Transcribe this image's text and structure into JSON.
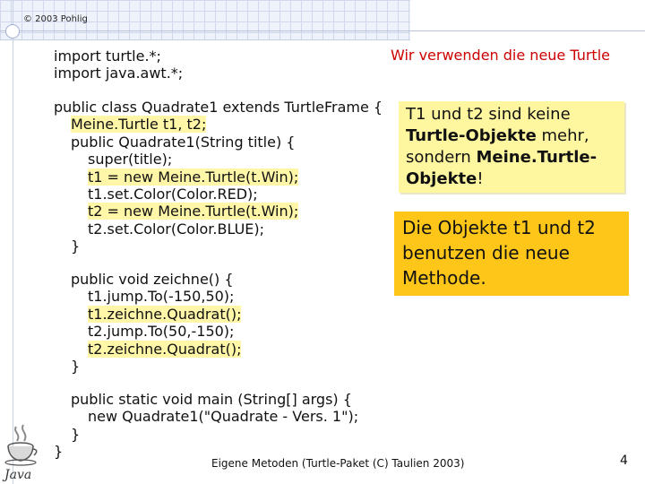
{
  "header": {
    "copyright": "© 2003 Pohlig"
  },
  "subtitle": "Wir verwenden die neue Turtle",
  "code": {
    "imports": [
      "import turtle.*;",
      "import java.awt.*;"
    ],
    "class_block": [
      {
        "text": "public class Quadrate1 extends TurtleFrame {",
        "indent": 0,
        "highlight": false
      },
      {
        "text": "Meine.Turtle t1, t2;",
        "indent": 1,
        "highlight": true
      },
      {
        "text": "public Quadrate1(String title) {",
        "indent": 1,
        "highlight": false
      },
      {
        "text": "super(title);",
        "indent": 2,
        "highlight": false
      },
      {
        "text": "t1 = new Meine.Turtle(t.Win);",
        "indent": 2,
        "highlight": true
      },
      {
        "text": "t1.set.Color(Color.RED);",
        "indent": 2,
        "highlight": false
      },
      {
        "text": "t2 = new Meine.Turtle(t.Win);",
        "indent": 2,
        "highlight": true
      },
      {
        "text": "t2.set.Color(Color.BLUE);",
        "indent": 2,
        "highlight": false
      },
      {
        "text": "}",
        "indent": 1,
        "highlight": false
      }
    ],
    "method_block": [
      {
        "text": "public void zeichne() {",
        "indent": 1,
        "highlight": false
      },
      {
        "text": "t1.jump.To(-150,50);",
        "indent": 2,
        "highlight": false
      },
      {
        "text": "t1.zeichne.Quadrat();",
        "indent": 2,
        "highlight": true
      },
      {
        "text": "t2.jump.To(50,-150);",
        "indent": 2,
        "highlight": false
      },
      {
        "text": "t2.zeichne.Quadrat();",
        "indent": 2,
        "highlight": true
      },
      {
        "text": "}",
        "indent": 1,
        "highlight": false
      }
    ],
    "main_block": [
      {
        "text": "public static void main (String[] args) {",
        "indent": 1,
        "highlight": false
      },
      {
        "text": "new Quadrate1(\"Quadrate - Vers. 1\");",
        "indent": 2,
        "highlight": false
      },
      {
        "text": "}",
        "indent": 1,
        "highlight": false
      },
      {
        "text": "}",
        "indent": 0,
        "highlight": false
      }
    ]
  },
  "note1": {
    "part1": "T1 und t2 sind keine ",
    "bold1": "Turtle-Objekte",
    "part2": " mehr, sondern ",
    "bold2": "Meine.Turtle-Objekte",
    "part3": "!"
  },
  "note2": {
    "text": "Die Objekte t1 und t2 benutzen die neue Methode."
  },
  "footer": {
    "text": "Eigene Metoden (Turtle-Paket (C) Taulien 2003)",
    "page": "4"
  },
  "logo": {
    "text": "Java",
    "icon": "java-coffee-cup-icon"
  },
  "colors": {
    "note1_bg": "#fff7a0",
    "note2_bg": "#ffc61a",
    "subtitle": "#cc0000",
    "highlight": "#fff6a8"
  }
}
